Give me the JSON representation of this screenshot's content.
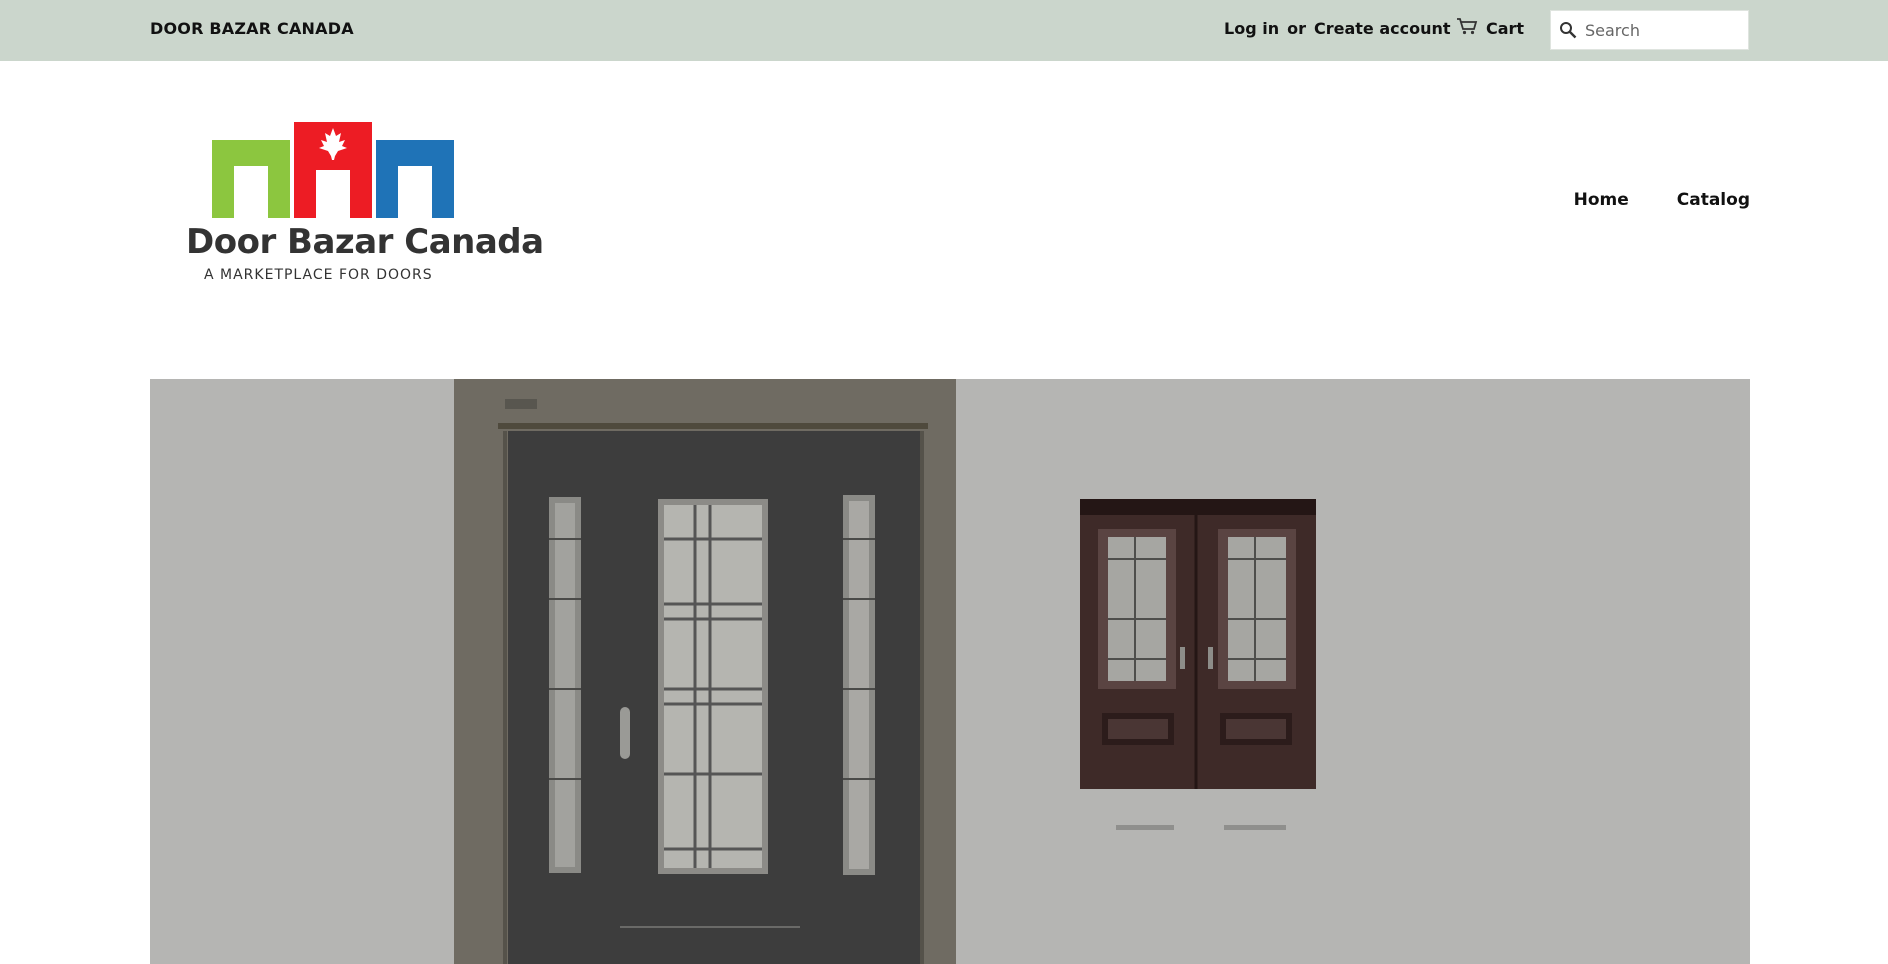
{
  "topbar": {
    "store_name": "DOOR BAZAR CANADA",
    "login_label": "Log in",
    "or_label": "or",
    "create_account_label": "Create account",
    "cart_label": "Cart",
    "search_placeholder": "Search"
  },
  "logo": {
    "title": "Door Bazar Canada",
    "subtitle": "A MARKETPLACE FOR DOORS",
    "colors": {
      "green": "#8cc63f",
      "red": "#ed1c24",
      "blue": "#1f73b7"
    }
  },
  "nav": {
    "items": [
      {
        "label": "Home"
      },
      {
        "label": "Catalog"
      }
    ]
  },
  "hero": {
    "colors": {
      "background": "#b5b5b3",
      "left_panel": "#6f6b62",
      "door_dark": "#3d3d3d",
      "door_brown": "#3e2a28"
    }
  }
}
